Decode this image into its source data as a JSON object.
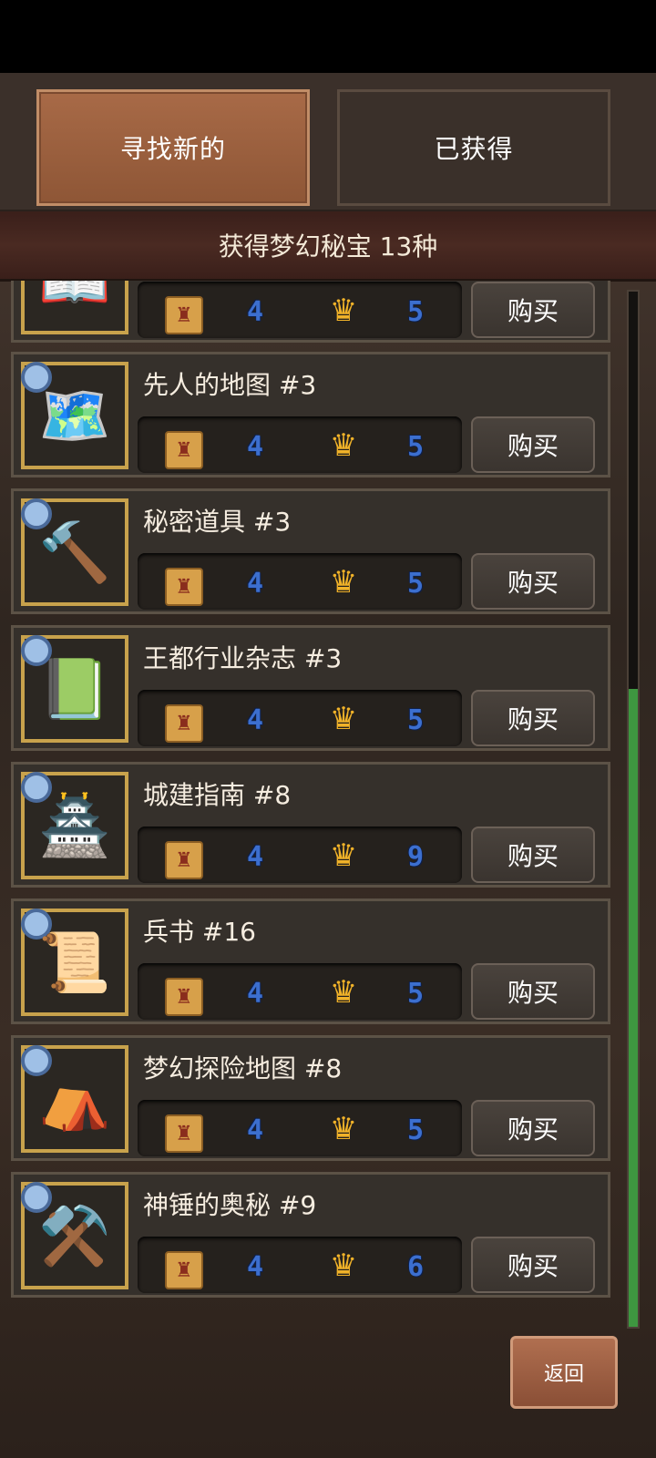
{
  "tabs": {
    "find_new": "寻找新的",
    "owned": "已获得"
  },
  "banner": "获得梦幻秘宝 13种",
  "items": [
    {
      "title": "",
      "trophy": "4",
      "crown": "5",
      "buy": "购买",
      "icon": "book-icon",
      "art": "📖"
    },
    {
      "title": "先人的地图 #3",
      "trophy": "4",
      "crown": "5",
      "buy": "购买",
      "icon": "treasure-map-icon",
      "art": "🗺️"
    },
    {
      "title": "秘密道具 #3",
      "trophy": "4",
      "crown": "5",
      "buy": "购买",
      "icon": "mystery-hammer-icon",
      "art": "🔨"
    },
    {
      "title": "王都行业杂志 #3",
      "trophy": "4",
      "crown": "5",
      "buy": "购买",
      "icon": "magazine-icon",
      "art": "📗"
    },
    {
      "title": "城建指南 #8",
      "trophy": "4",
      "crown": "9",
      "buy": "购买",
      "icon": "city-guide-icon",
      "art": "🏯"
    },
    {
      "title": "兵书 #16",
      "trophy": "4",
      "crown": "5",
      "buy": "购买",
      "icon": "military-book-icon",
      "art": "📜"
    },
    {
      "title": "梦幻探险地图 #8",
      "trophy": "4",
      "crown": "5",
      "buy": "购买",
      "icon": "tent-icon",
      "art": "⛺"
    },
    {
      "title": "神锤的奥秘 #9",
      "trophy": "4",
      "crown": "6",
      "buy": "购买",
      "icon": "anvil-hammer-icon",
      "art": "⚒️"
    }
  ],
  "back": "返回",
  "colors": {
    "accent": "#a86a47",
    "scroll": "#3e9740",
    "frame": "#c8a24c"
  }
}
